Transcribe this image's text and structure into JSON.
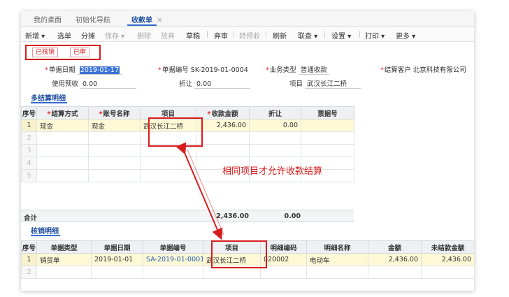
{
  "tabs": [
    {
      "label": "我的桌面"
    },
    {
      "label": "初始化导航"
    },
    {
      "label": "收款单",
      "close": "✕"
    }
  ],
  "toolbar": {
    "new": "新增 ▾",
    "select_source": "选单",
    "split": "分摊",
    "save": "保存 ▾",
    "delete": "删除",
    "abandon": "放弃",
    "draft": "草稿",
    "review": "弃审",
    "to_pre": "转预收",
    "refresh": "刷新",
    "query": "联查 ▾",
    "settings": "设置 ▾",
    "print": "打印 ▾",
    "more": "更多 ▾"
  },
  "status": {
    "written_off": "已核销",
    "audited": "已审"
  },
  "form": {
    "date_label": "单据日期",
    "date_value": "2019-01-17",
    "number_label": "单据编号",
    "number_value": "SK-2019-01-0004",
    "biz_type_label": "业务类型",
    "biz_type_value": "普通收款",
    "customer_label": "结算客户",
    "customer_value": "北京科技有限公司",
    "prepay_label": "使用预收",
    "prepay_value": "0.00",
    "discount_label": "折让",
    "discount_value": "0.00",
    "project_label": "项目",
    "project_value": "武汉长江二桥"
  },
  "settlement": {
    "title": "多结算明细",
    "columns": [
      "序号",
      "结算方式",
      "账号名称",
      "项目",
      "收款金额",
      "折让",
      "票据号"
    ],
    "rows": [
      {
        "seq": "1",
        "method": "现金",
        "account": "现金",
        "project": "武汉长江二桥",
        "amount": "2,436.00",
        "discount": "0.00",
        "bill_no": ""
      },
      {
        "seq": "2"
      },
      {
        "seq": "3"
      },
      {
        "seq": "4"
      },
      {
        "seq": "5"
      }
    ],
    "total_label": "合计",
    "total_amount": "2,436.00",
    "total_discount": "0.00"
  },
  "writeoff": {
    "title": "核销明细",
    "columns": [
      "序号",
      "单据类型",
      "单据日期",
      "单据编号",
      "项目",
      "明细编码",
      "明细名称",
      "金额",
      "未结款金额"
    ],
    "rows": [
      {
        "seq": "1",
        "type": "销货单",
        "date": "2019-01-01",
        "number": "SA-2019-01-0001",
        "project": "武汉长江二桥",
        "code": "020002",
        "name": "电动车",
        "amount": "2,436.00",
        "unsettled": "2,436.00"
      },
      {
        "seq": "2"
      }
    ]
  },
  "annotation": "相同项目才允许收款结算",
  "colors": {
    "accent": "#2f6bcc",
    "highlight": "#d81b1b",
    "row_highlight": "#fdf8d6"
  }
}
